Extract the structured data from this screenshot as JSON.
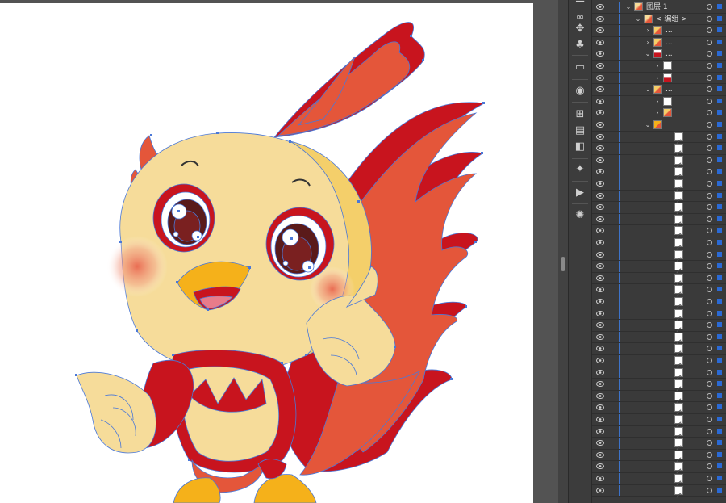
{
  "layers_panel": {
    "rows": [
      {
        "name": "图层 1",
        "level": 0,
        "expanded": true,
        "thumb": "bird"
      },
      {
        "name": "< 编组 >",
        "level": 1,
        "expanded": true,
        "thumb": "bird"
      },
      {
        "name": "...",
        "level": 2,
        "expanded": false,
        "thumb": "mixed"
      },
      {
        "name": "...",
        "level": 2,
        "expanded": false,
        "thumb": "mixed"
      },
      {
        "name": "...",
        "level": 2,
        "expanded": true,
        "thumb": "red"
      },
      {
        "name": "",
        "level": 3,
        "expanded": false,
        "thumb": "blank"
      },
      {
        "name": "",
        "level": 3,
        "expanded": false,
        "thumb": "red"
      },
      {
        "name": "...",
        "level": 2,
        "expanded": true,
        "thumb": "mixed"
      },
      {
        "name": "",
        "level": 3,
        "expanded": false,
        "thumb": "blank"
      },
      {
        "name": "",
        "level": 3,
        "expanded": false,
        "thumb": "mixed"
      },
      {
        "name": "",
        "level": 2,
        "expanded": true,
        "thumb": "yellow"
      }
    ],
    "path_row_count": 31
  },
  "colors": {
    "selection": "#4a78d8",
    "layer_bar": "#3d73c9",
    "panel_bg": "#3a3a3a",
    "canvas_bg": "#535353",
    "artboard_bg": "#ffffff"
  },
  "tool_icons": [
    "scroll-up-icon",
    "link-icon",
    "puppet-warp-icon",
    "club-symbol-icon",
    "rectangle-panel-icon",
    "color-wheel-icon",
    "transform-icon",
    "align-icon",
    "pathfinder-icon",
    "magic-wand-icon",
    "play-action-icon",
    "brightness-icon"
  ]
}
